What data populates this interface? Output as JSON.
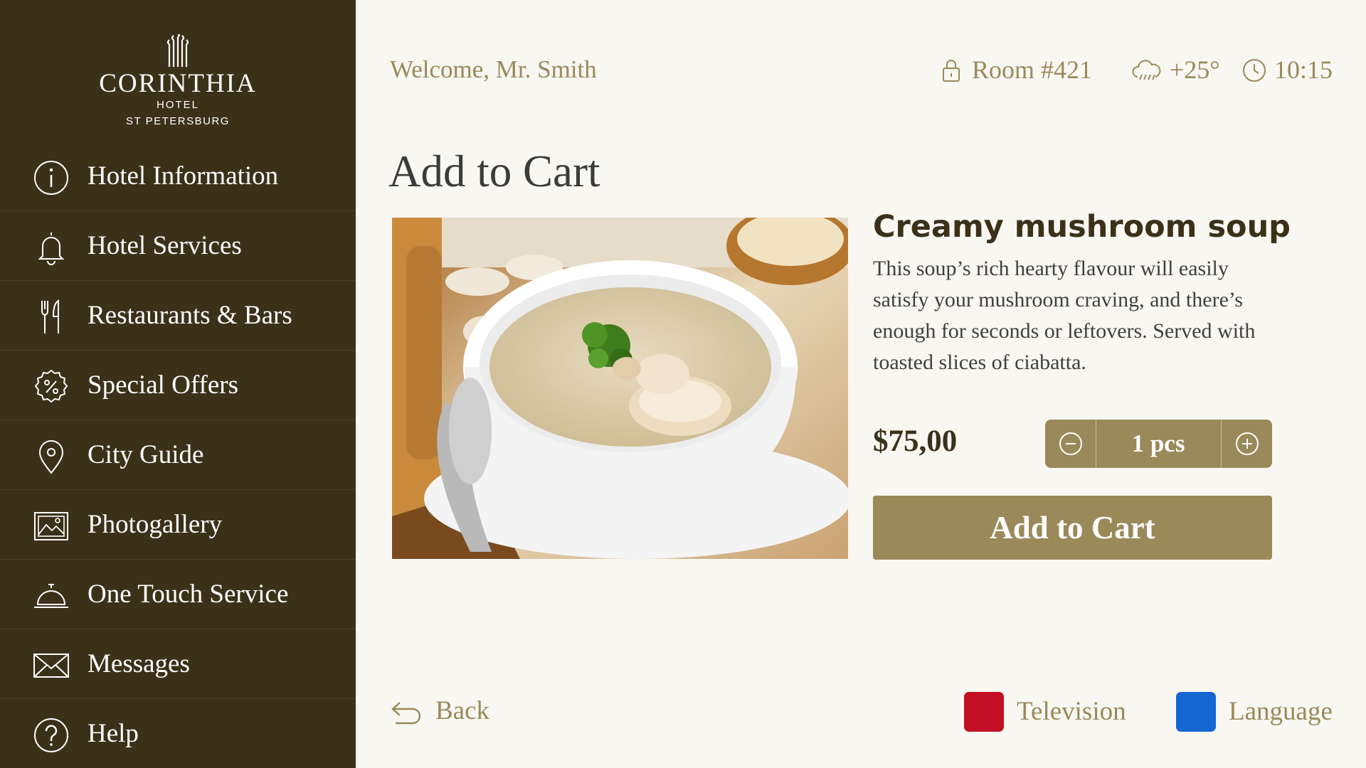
{
  "brand": {
    "name": "CORINTHIA",
    "line1": "HOTEL",
    "line2": "ST PETERSBURG"
  },
  "sidebar": {
    "items": [
      {
        "label": "Hotel Information",
        "icon": "info-icon"
      },
      {
        "label": "Hotel Services",
        "icon": "bell-icon"
      },
      {
        "label": "Restaurants & Bars",
        "icon": "fork-knife-icon"
      },
      {
        "label": "Special Offers",
        "icon": "percent-badge-icon"
      },
      {
        "label": "City Guide",
        "icon": "map-pin-icon"
      },
      {
        "label": "Photogallery",
        "icon": "picture-icon"
      },
      {
        "label": "One Touch Service",
        "icon": "service-bell-icon"
      },
      {
        "label": "Messages",
        "icon": "envelope-icon"
      },
      {
        "label": "Help",
        "icon": "question-icon"
      }
    ]
  },
  "header": {
    "welcome": "Welcome, Mr. Smith",
    "room": "Room #421",
    "weather": "+25°",
    "time": "10:15"
  },
  "main": {
    "title": "Add to Cart",
    "product": {
      "name": "Creamy mushroom soup",
      "description": "This soup’s rich hearty flavour will easily satisfy your mushroom craving, and there’s enough for seconds or leftovers. Served with toasted slices of ciabatta.",
      "price": "$75,00",
      "quantity": "1 pcs",
      "image": "mushroom-soup-photo"
    },
    "add_button": "Add to Cart"
  },
  "footer": {
    "back": "Back",
    "television": "Television",
    "language": "Language"
  },
  "colors": {
    "sidebar_bg": "#3b3119",
    "page_bg": "#f9f7f2",
    "accent_gold": "#9a8959",
    "television_key": "#c30f24",
    "language_key": "#1565d2"
  }
}
